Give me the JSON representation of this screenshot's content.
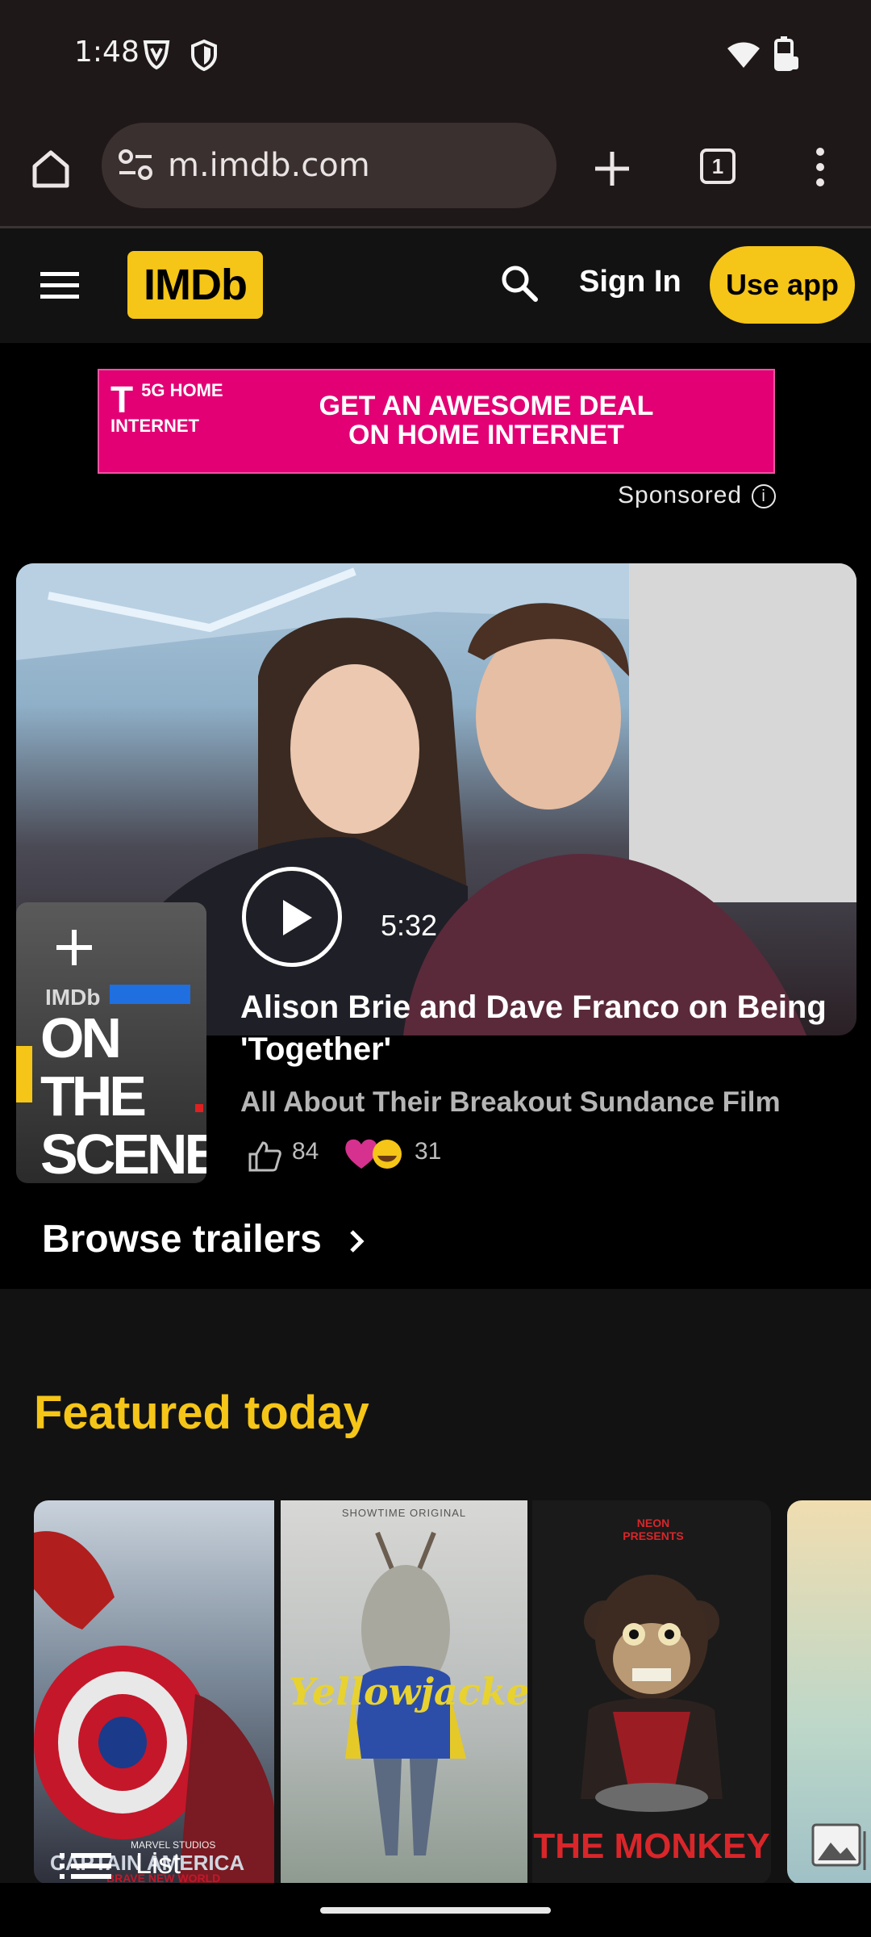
{
  "status_bar": {
    "time": "1:48"
  },
  "browser": {
    "url": "m.imdb.com",
    "tab_count": "1"
  },
  "imdb_header": {
    "logo": "IMDb",
    "sign_in": "Sign In",
    "use_app": "Use app"
  },
  "ad": {
    "brand_line1": "5G HOME",
    "brand_line2": "INTERNET",
    "headline_line1": "GET AN AWESOME DEAL",
    "headline_line2": "ON HOME INTERNET",
    "sponsored": "Sponsored"
  },
  "hero_video": {
    "thumb_brand": "IMDb",
    "thumb_line1": "ON THE",
    "thumb_line2": "SCENE",
    "duration": "5:32",
    "title": "Alison Brie and Dave Franco on Being 'Together'",
    "subtitle": "All About Their Breakout Sundance Film",
    "likes": "84",
    "reactions": "31"
  },
  "browse_trailers": "Browse trailers",
  "featured": {
    "title": "Featured today",
    "posters": [
      {
        "top_text": "MARVEL STUDIOS",
        "bottom_text": "CAPTAIN AMERICA",
        "tagline": "BRAVE NEW WORLD"
      },
      {
        "top_text": "SHOWTIME ORIGINAL",
        "title": "Yellowjackets"
      },
      {
        "top_text": "NEON PRESENTS",
        "title": "THE MONKEY"
      }
    ],
    "list_label": "List"
  },
  "colors": {
    "imdb_yellow": "#f5c518",
    "tmobile_magenta": "#e20074",
    "header_bg": "#121212",
    "browser_bg": "#1f1818"
  }
}
